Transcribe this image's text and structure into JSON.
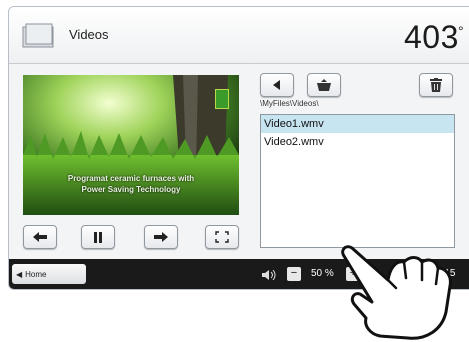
{
  "header": {
    "title": "Videos",
    "temperature": "403",
    "temperature_unit": "°"
  },
  "video": {
    "overlay_line1": "Programat ceramic furnaces with",
    "overlay_line2": "Power Saving Technology"
  },
  "path": "\\MyFiles\\Videos\\",
  "files": [
    {
      "name": "Video1.wmv",
      "selected": true
    },
    {
      "name": "Video2.wmv",
      "selected": false
    }
  ],
  "footer": {
    "home_label": "Home",
    "volume": "50 %",
    "clock": "9:15"
  },
  "colors": {
    "selection": "#c7e4f1",
    "footer_bg": "#1a1a1a",
    "accent_green": "#3a9a2a"
  },
  "icons": [
    "folder-icon",
    "back-icon",
    "open-folder-icon",
    "trash-icon",
    "rewind-icon",
    "pause-icon",
    "forward-icon",
    "fullscreen-icon",
    "speaker-icon"
  ]
}
